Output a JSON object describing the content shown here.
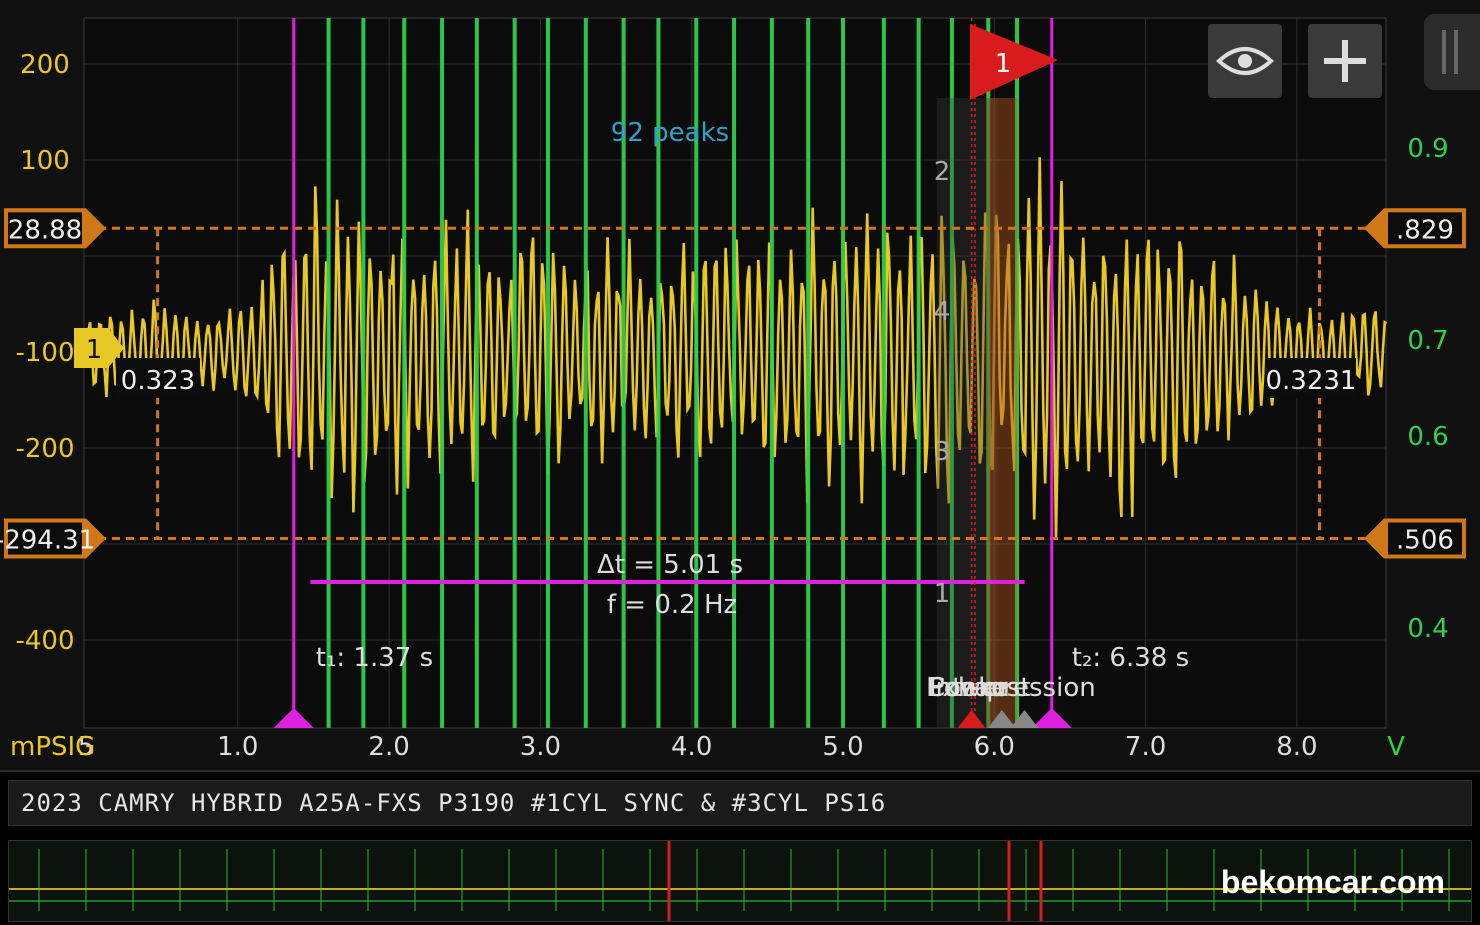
{
  "chart_data": {
    "type": "line",
    "x_ticks": [
      "1.0",
      "2.0",
      "3.0",
      "4.0",
      "5.0",
      "6.0",
      "7.0",
      "8.0"
    ],
    "x_first_tick_partial": "5",
    "xlim": [
      0.0,
      8.6
    ],
    "left_axis": {
      "ticks": [
        "200",
        "100",
        "-100",
        "-200",
        "-400"
      ],
      "tick_values": [
        200,
        100,
        -100,
        -200,
        -400
      ],
      "ylim": [
        -495,
        230
      ],
      "unit": "mPSIG",
      "color": "#e8c825"
    },
    "right_axis": {
      "ticks": [
        "0.9",
        "0.7",
        "0.6",
        "0.4"
      ],
      "tick_values": [
        0.9,
        0.7,
        0.6,
        0.4
      ],
      "hidden_ticks": [
        "0.8",
        "0.8"
      ],
      "unit": "V",
      "color": "#2fd04a"
    },
    "series": [
      {
        "name": "1",
        "color": "#e8c825",
        "description_x": [
          0.0,
          8.6
        ],
        "level_shift": -100
      }
    ],
    "peaks_label": "92 peaks",
    "peak_lines_x": [
      1.6,
      1.83,
      2.1,
      2.35,
      2.58,
      2.83,
      3.05,
      3.3,
      3.55,
      3.78,
      4.03,
      4.28,
      4.53,
      4.77,
      5.0,
      5.27,
      5.5,
      5.72,
      5.96,
      6.15
    ],
    "cursors": {
      "t1": {
        "label": "t₁: 1.37 s",
        "x": 1.37
      },
      "t2": {
        "label": "t₂: 6.38 s",
        "x": 6.38
      },
      "dt": "Δt = 5.01 s",
      "freq": "f = 0.2 Hz"
    },
    "h_cursors": {
      "left_top": "28.88",
      "left_bottom": "-294.31",
      "right_top": ".829",
      "right_bottom": ".506",
      "top_value_left": 28.88,
      "bottom_value_left": -294.31,
      "top_value_right": 0.829,
      "bottom_value_right": 0.506
    },
    "reference_labels": {
      "left": "0.323",
      "right": "0.3231"
    },
    "marker_numbers": [
      "2",
      "4",
      "3",
      "1"
    ],
    "trigger_flag": "1",
    "channel_tag": "1",
    "stroke_labels": [
      "Exhaust",
      "Compression",
      "Intake",
      "Power"
    ]
  },
  "title": "2023 CAMRY HYBRID A25A-FXS P3190 #1CYL SYNC & #3CYL PS16",
  "watermark": "bekomcar.com",
  "buttons": {
    "visibility": "eye-icon",
    "add": "plus-icon"
  },
  "colors": {
    "yellow": "#e8c825",
    "green": "#2fd04a",
    "magenta": "#e020e0",
    "orange": "#d07818",
    "red": "#d81c1c",
    "cyan": "#2fa0c8"
  }
}
